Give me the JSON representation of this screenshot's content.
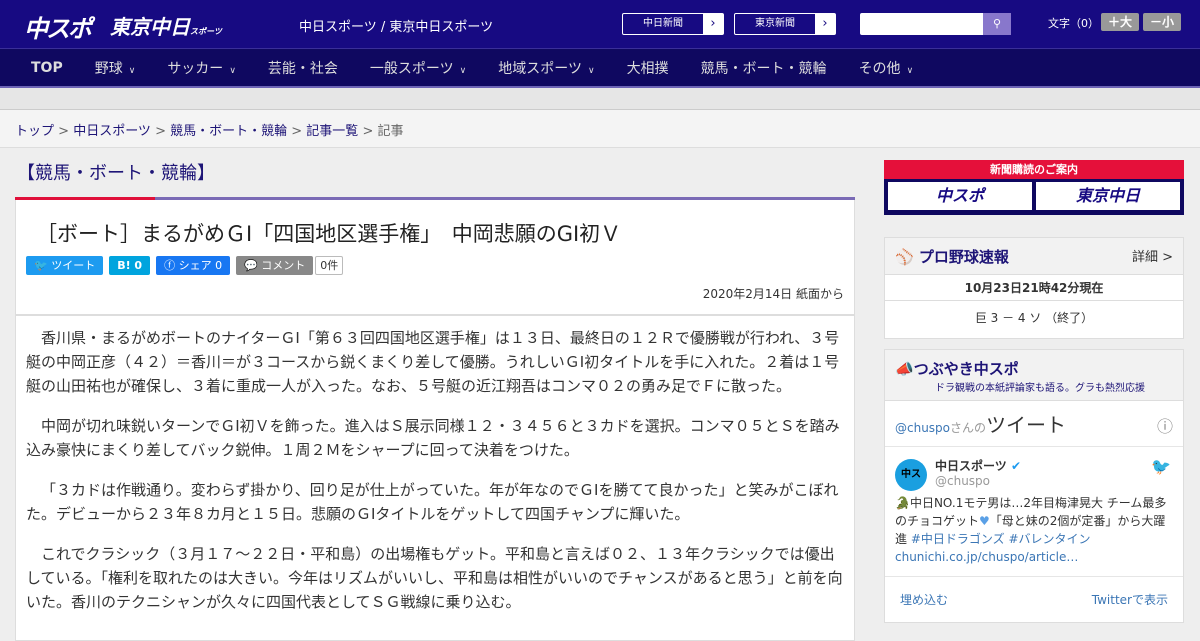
{
  "header": {
    "logo_main": "中スポ",
    "logo_tokyo": "東京中日",
    "logo_tokyo_sub": "スポーツ",
    "tagline": "中日スポーツ / 東京中日スポーツ",
    "links": [
      "中日新聞",
      "東京新聞"
    ],
    "search_placeholder": "",
    "font_label": "文字（0）",
    "font_larger": "＋大",
    "font_smaller": "－小"
  },
  "nav": [
    {
      "label": "TOP"
    },
    {
      "label": "野球",
      "chev": "∨"
    },
    {
      "label": "サッカー",
      "chev": "∨"
    },
    {
      "label": "芸能・社会"
    },
    {
      "label": "一般スポーツ",
      "chev": "∨"
    },
    {
      "label": "地域スポーツ",
      "chev": "∨"
    },
    {
      "label": "大相撲"
    },
    {
      "label": "競馬・ボート・競輪"
    },
    {
      "label": "その他",
      "chev": "∨"
    }
  ],
  "breadcrumb": [
    "トップ",
    "中日スポーツ",
    "競馬・ボート・競輪",
    "記事一覧",
    "記事"
  ],
  "section_title": "【競馬・ボート・競輪】",
  "article": {
    "title": "［ボート］まるがめＧⅠ「四国地区選手権」　中岡悲願のGI初Ｖ",
    "share": {
      "tweet": "ツイート",
      "hatena": "B! 0",
      "facebook": "シェア 0",
      "comment": "コメント",
      "comment_count": "0件"
    },
    "date": "2020年2月14日 紙面から",
    "paragraphs": [
      "香川県・まるがめボートのナイターＧⅠ「第６３回四国地区選手権」は１３日、最終日の１２Ｒで優勝戦が行われ、３号艇の中岡正彦（４２）＝香川＝が３コースから鋭くまくり差して優勝。うれしいＧⅠ初タイトルを手に入れた。２着は１号艇の山田祐也が確保し、３着に重成一人が入った。なお、５号艇の近江翔吾はコンマ０２の勇み足でＦに散った。",
      "中岡が切れ味鋭いターンでＧⅠ初Ｖを飾った。進入はＳ展示同様１２・３４５６と３カドを選択。コンマ０５とＳを踏み込み豪快にまくり差してバック鋭伸。１周２Ｍをシャープに回って決着をつけた。",
      "「３カドは作戦通り。変わらず掛かり、回り足が仕上がっていた。年が年なのでＧⅠを勝てて良かった」と笑みがこぼれた。デビューから２３年８カ月と１５日。悲願のＧⅠタイトルをゲットして四国チャンプに輝いた。",
      "これでクラシック（３月１７～２２日・平和島）の出場権もゲット。平和島と言えば０２、１３年クラシックでは優出している。「権利を取れたのは大きい。今年はリズムがいいし、平和島は相性がいいのでチャンスがあると思う」と前を向いた。香川のテクニシャンが久々に四国代表としてＳＧ戦線に乗り込む。"
    ]
  },
  "sidebar": {
    "subscribe": {
      "title": "新聞購読のご案内",
      "buttons": [
        "中スポ",
        "東京中日"
      ]
    },
    "baseball": {
      "title": "プロ野球速報",
      "detail": "詳細 >",
      "timestamp": "10月23日21時42分現在",
      "score": "巨 3 － 4 ソ （終了）"
    },
    "tweets": {
      "title": "つぶやき中スポ",
      "subtitle": "ドラ観戦の本紙評論家も語る。グラも熱烈応援",
      "handle_prefix": "@chuspo",
      "handle_suffix": "さんの",
      "header": "ツイート",
      "account_name": "中日スポーツ",
      "account_handle": "@chuspo",
      "tweet_text": "中日NO.1モテ男は…2年目梅津晃大 チーム最多のチョコゲット",
      "tweet_text2": "「母と妹の2個が定番」から大躍進",
      "hashtags": "#中日ドラゴンズ #バレンタイン",
      "link": "chunichi.co.jp/chuspo/article…",
      "embed": "埋め込む",
      "view_on_twitter": "Twitterで表示"
    }
  }
}
